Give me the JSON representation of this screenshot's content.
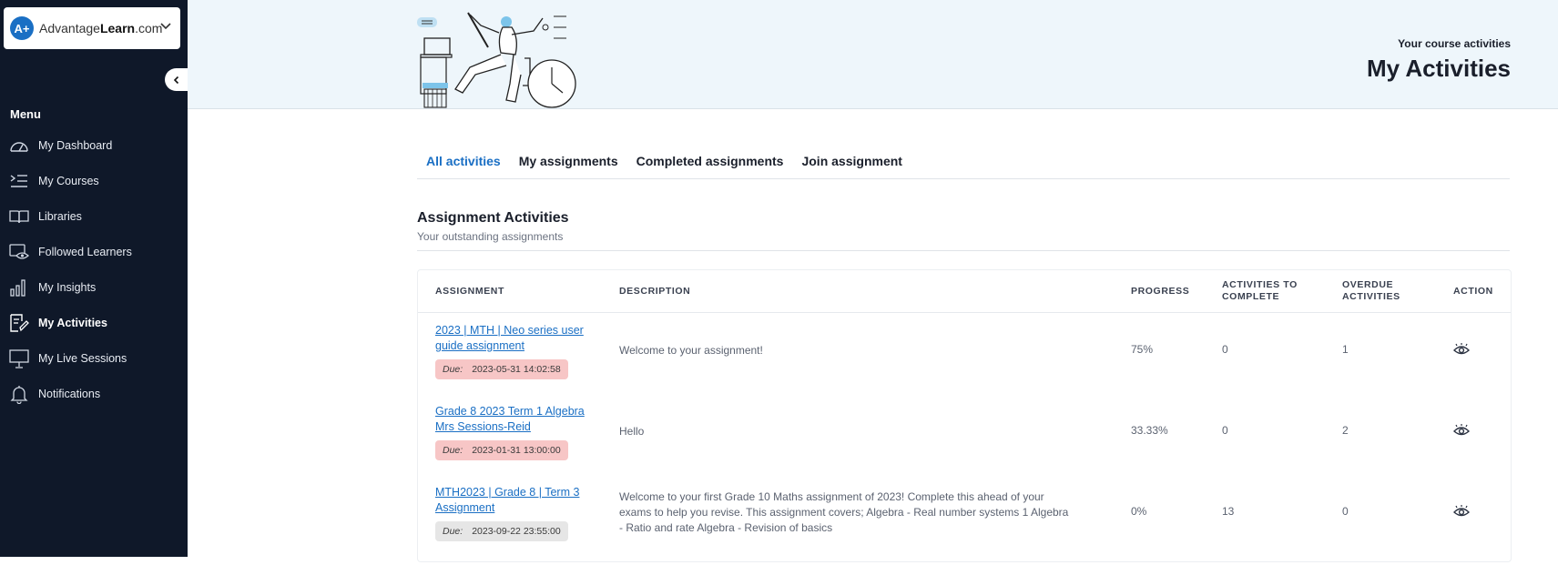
{
  "brand": {
    "prefix": "Advantage",
    "bold": "Learn",
    "suffix": ".com",
    "logo": "A+"
  },
  "menu_title": "Menu",
  "nav": [
    {
      "label": "My Dashboard",
      "icon": "dashboard-gauge-icon"
    },
    {
      "label": "My Courses",
      "icon": "courses-list-icon"
    },
    {
      "label": "Libraries",
      "icon": "book-icon"
    },
    {
      "label": "Followed Learners",
      "icon": "eye-card-icon"
    },
    {
      "label": "My Insights",
      "icon": "bar-chart-icon"
    },
    {
      "label": "My Activities",
      "icon": "edit-document-icon",
      "active": true
    },
    {
      "label": "My Live Sessions",
      "icon": "presentation-icon"
    },
    {
      "label": "Notifications",
      "icon": "bell-icon"
    }
  ],
  "header": {
    "subtitle": "Your course activities",
    "title": "My Activities"
  },
  "tabs": [
    "All activities",
    "My assignments",
    "Completed assignments",
    "Join assignment"
  ],
  "section": {
    "title": "Assignment Activities",
    "subtitle": "Your outstanding assignments"
  },
  "table": {
    "columns": {
      "assignment": "ASSIGNMENT",
      "description": "DESCRIPTION",
      "progress": "PROGRESS",
      "activities_line1": "ACTIVITIES TO",
      "activities_line2": "COMPLETE",
      "overdue_line1": "OVERDUE",
      "overdue_line2": "ACTIVITIES",
      "action": "ACTION"
    },
    "due_label": "Due:",
    "rows": [
      {
        "name": "2023 | MTH | Neo series user guide assignment",
        "due": "2023-05-31 14:02:58",
        "description": "Welcome to your assignment!",
        "progress": "75%",
        "to_complete": "0",
        "overdue": "1"
      },
      {
        "name": "Grade 8 2023 Term 1 Algebra Mrs Sessions-Reid",
        "due": "2023-01-31 13:00:00",
        "description": "Hello",
        "progress": "33.33%",
        "to_complete": "0",
        "overdue": "2"
      },
      {
        "name": "MTH2023 | Grade 8 | Term 3 Assignment",
        "due": "2023-09-22 23:55:00",
        "description": "Welcome to your first Grade 10 Maths assignment of 2023! Complete this ahead of your exams to help you revise.  This assignment covers; Algebra - Real number systems 1 Algebra - Ratio and rate Algebra - Revision of basics",
        "progress": "0%",
        "to_complete": "13",
        "overdue": "0"
      }
    ]
  },
  "colors": {
    "sidebar": "#0f1829",
    "accent": "#1a6fc4",
    "due_red": "#f7c6c6",
    "due_grey": "#e6e6e6",
    "header_bg": "#eef6fb"
  }
}
